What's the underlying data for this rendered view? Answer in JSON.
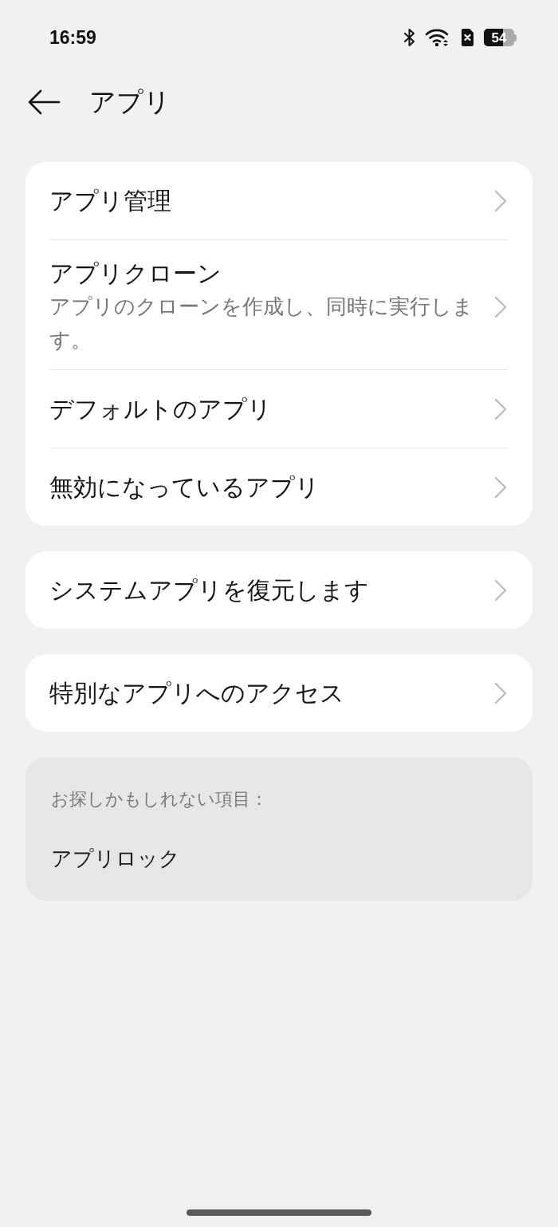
{
  "status_bar": {
    "time": "16:59",
    "battery": "54"
  },
  "header": {
    "title": "アプリ"
  },
  "groups": [
    {
      "items": [
        {
          "title": "アプリ管理"
        },
        {
          "title": "アプリクローン",
          "subtitle": "アプリのクローンを作成し、同時に実行します。"
        },
        {
          "title": "デフォルトのアプリ"
        },
        {
          "title": "無効になっているアプリ"
        }
      ]
    },
    {
      "items": [
        {
          "title": "システムアプリを復元します"
        }
      ]
    },
    {
      "items": [
        {
          "title": "特別なアプリへのアクセス"
        }
      ]
    }
  ],
  "suggestions": {
    "heading": "お探しかもしれない項目：",
    "items": [
      "アプリロック"
    ]
  }
}
